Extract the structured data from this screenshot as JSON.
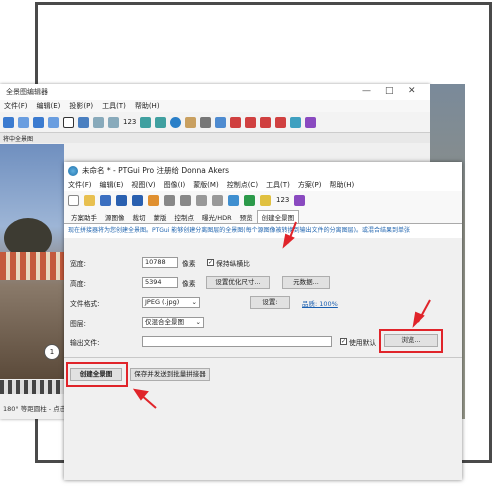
{
  "bg_window": {
    "title": "全景图编辑器",
    "menu": [
      "文件(F)",
      "编辑(E)",
      "投影(P)",
      "工具(T)",
      "帮助(H)"
    ],
    "toolbar_number": "123",
    "label_strip": "将中全景图",
    "marker_number": "1",
    "status": "180° 等距圆柱 - 点击"
  },
  "main_window": {
    "title": "未命名 * - PTGui Pro 注册给 Donna Akers",
    "menu": [
      "文件(F)",
      "编辑(E)",
      "视图(V)",
      "图像(I)",
      "蒙版(M)",
      "控制点(C)",
      "工具(T)",
      "方案(P)",
      "帮助(H)"
    ],
    "toolbar_number": "123",
    "tabs": [
      "方案助手",
      "源图像",
      "裁切",
      "蒙版",
      "控制点",
      "曝光/HDR",
      "预览",
      "创建全景图"
    ],
    "active_tab_index": 7,
    "info_text": "现在拼接器将为您创建全景图。PTGui 能够创建分离图层的全景图(每个源图像被转换到输出文件的分离图层)。或混合结果到单张"
  },
  "form": {
    "width_label": "宽度:",
    "width_value": "10788",
    "width_unit": "像素",
    "keep_ratio_label": "保持纵横比",
    "keep_ratio_checked": "✓",
    "height_label": "高度:",
    "height_value": "5394",
    "height_unit": "像素",
    "optimize_button": "设置优化尺寸...",
    "metadata_button": "元数据...",
    "format_label": "文件格式:",
    "format_value": "JPEG (.jpg)",
    "settings_button": "设置:",
    "quality_text": "品质: 100%",
    "layer_label": "图层:",
    "layer_value": "仅混合全景图",
    "output_label": "输出文件:",
    "use_default_label": "使用默认",
    "use_default_checked": "✓",
    "browse_button": "浏览...",
    "create_button": "创建全景图",
    "save_batch_button": "保存并发送到批量拼接器"
  },
  "colors": {
    "highlight": "#e0242a",
    "link": "#1a5fb0"
  }
}
